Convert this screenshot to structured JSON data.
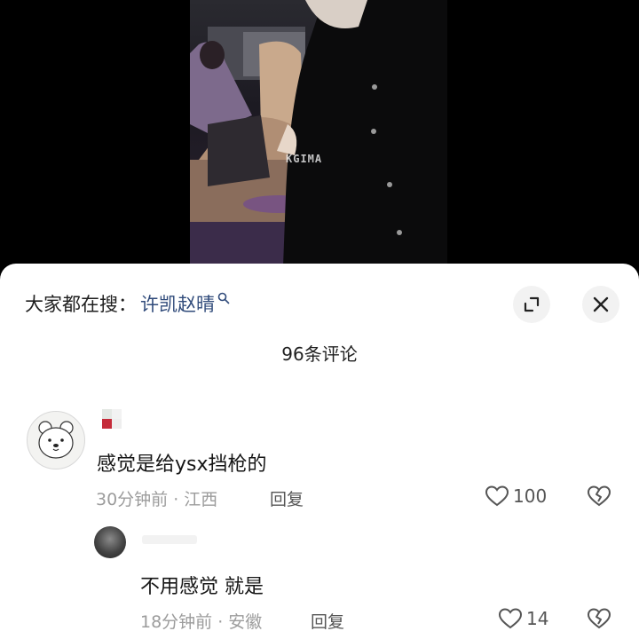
{
  "video": {
    "watermark": "KGIMA"
  },
  "search_bar": {
    "prefix": "大家都在搜：",
    "term": "许凯赵晴",
    "icon": "search-icon"
  },
  "header_buttons": {
    "expand_icon": "expand-icon",
    "close_icon": "close-icon"
  },
  "comments_count_label": "96条评论",
  "comments": [
    {
      "avatar": "bear-avatar",
      "text": "感觉是给ysx挡枪的",
      "time_location": "30分钟前 · 江西",
      "reply_label": "回复",
      "likes": "100",
      "replies": [
        {
          "text": "不用感觉 就是",
          "time_location": "18分钟前 · 安徽",
          "reply_label": "回复",
          "likes": "14"
        }
      ]
    }
  ],
  "colors": {
    "sheet_bg": "#ffffff",
    "search_term": "#2f4a7a",
    "meta_text": "#9c9c9c",
    "button_bg": "#f2f2f2"
  }
}
